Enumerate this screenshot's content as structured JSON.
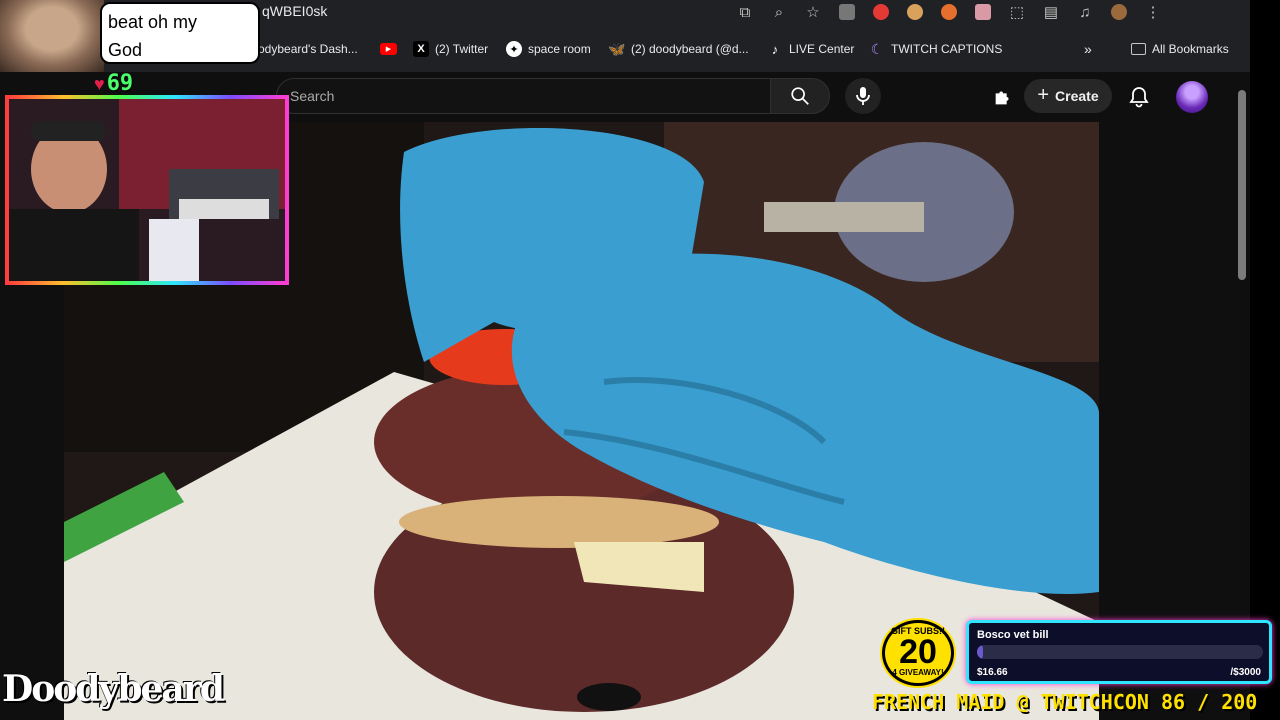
{
  "browser": {
    "url_fragment": "qWBEI0sk",
    "bookmarks": [
      {
        "label": "odybeard's Dash...",
        "icon": "dashboard-icon"
      },
      {
        "label": "",
        "icon": "youtube-icon"
      },
      {
        "label": "(2) Twitter",
        "icon": "x-icon"
      },
      {
        "label": "space room",
        "icon": "star-icon"
      },
      {
        "label": "(2) doodybeard (@d...",
        "icon": "bluesky-icon"
      },
      {
        "label": "LIVE Center",
        "icon": "tiktok-icon"
      },
      {
        "label": "TWITCH CAPTIONS",
        "icon": "moon-icon"
      }
    ],
    "all_bookmarks_label": "All Bookmarks"
  },
  "youtube": {
    "search_placeholder": "Search",
    "create_label": "Create"
  },
  "overlay": {
    "speech_bubble": "beat oh my\nGod",
    "hearts_count": "69",
    "gift": {
      "top": "GIFT SUBS!!",
      "number": "20",
      "bottom": "4 GIVEAWAY!"
    },
    "goal": {
      "title": "Bosco vet bill",
      "current": "$16.66",
      "target": "/$3000",
      "progress": 0.0056
    },
    "ticker": "FRENCH MAID @ TWITCHCON 86 / 200",
    "logo": "Doodybeard"
  },
  "colors": {
    "chrome_bg": "#202124",
    "youtube_bg": "#0f0f0f",
    "accent_yellow": "#ffe100",
    "glove_blue": "#3a9fd0"
  }
}
